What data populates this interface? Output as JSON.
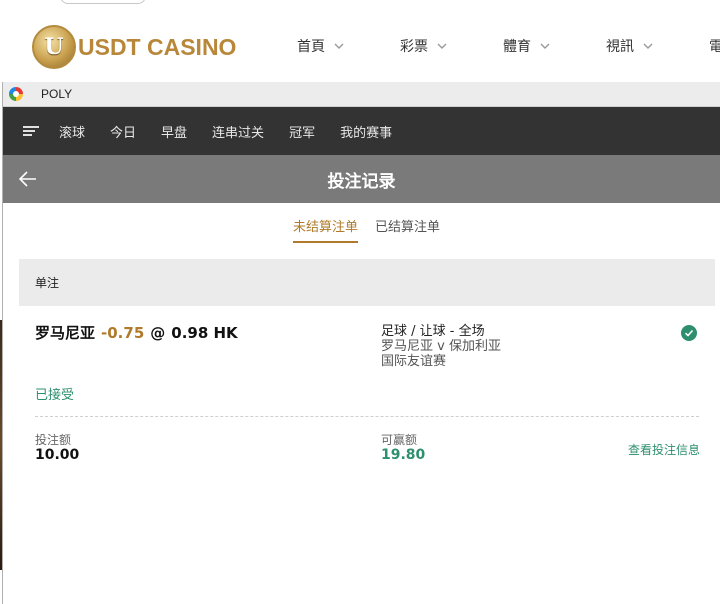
{
  "site": {
    "logo_text": "USDT CASINO",
    "logo_mark": "U",
    "nav": [
      {
        "label": "首頁"
      },
      {
        "label": "彩票"
      },
      {
        "label": "體育"
      },
      {
        "label": "視訊"
      },
      {
        "label": "電"
      }
    ]
  },
  "window": {
    "title": "POLY",
    "icon": "browser-icon"
  },
  "sports_nav": {
    "menu_icon": "hamburger-icon",
    "tabs": [
      {
        "label": "滚球"
      },
      {
        "label": "今日"
      },
      {
        "label": "早盘"
      },
      {
        "label": "连串过关"
      },
      {
        "label": "冠军"
      },
      {
        "label": "我的赛事"
      }
    ]
  },
  "page": {
    "title": "投注记录",
    "back_icon": "back-arrow-icon"
  },
  "record_tabs": {
    "active": "未结算注单",
    "inactive": "已结算注单"
  },
  "bet": {
    "type_label": "单注",
    "selection": "罗马尼亚",
    "handicap": "-0.75",
    "at_symbol": "@",
    "odds": "0.98 HK",
    "market": "足球 / 让球 - 全场",
    "match": "罗马尼亚 v 保加利亚",
    "league": "国际友谊赛",
    "status": "已接受",
    "stake_label": "投注额",
    "stake_value": "10.00",
    "payout_label": "可赢额",
    "payout_value": "19.80",
    "details_link": "查看投注信息"
  },
  "colors": {
    "accent_gold": "#b07a2a",
    "accent_green": "#2e8f6f",
    "dark_nav": "#333333",
    "sub_header": "#7a7a7a"
  }
}
